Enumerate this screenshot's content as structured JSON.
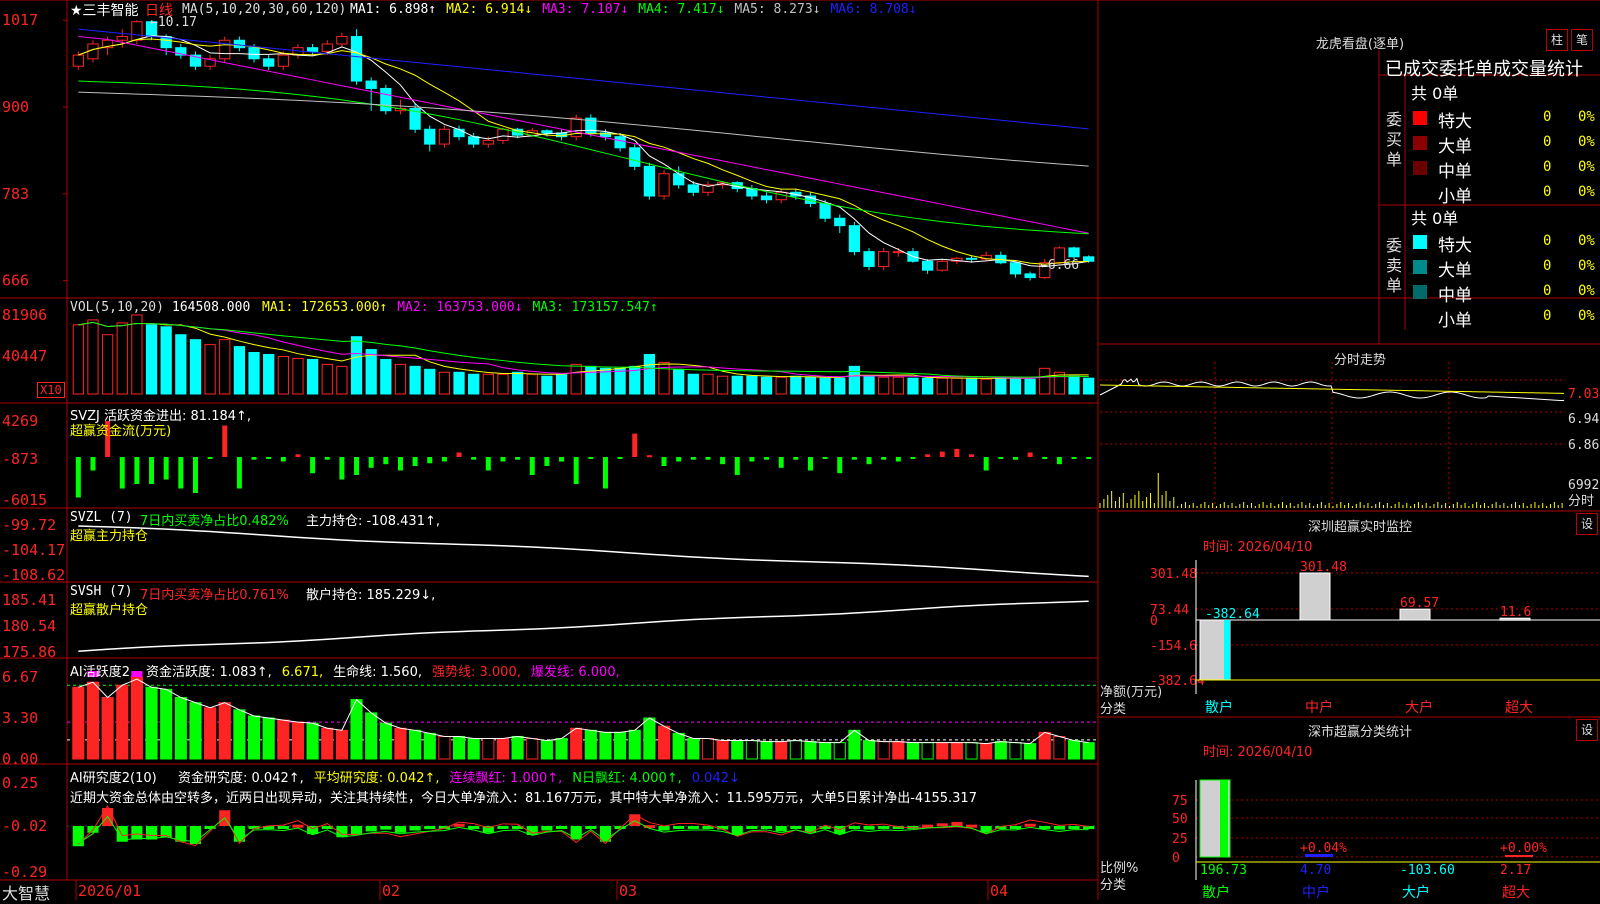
{
  "app": {
    "name": "大智慧"
  },
  "stock": {
    "title": "★三丰智能",
    "period": "日线"
  },
  "colors": {
    "up": "#ff2424",
    "down": "#00ffff",
    "grid": "#b00000",
    "bg": "#000000",
    "ma1": "#ffffff",
    "ma2": "#ffff00",
    "ma3": "#ff00ff",
    "ma4": "#00ff00",
    "ma5": "#c0c0c0",
    "ma6": "#2020ff"
  },
  "main_panel": {
    "indicator": "MA(5,10,20,30,60,120)",
    "items": [
      {
        "label": "MA1:",
        "value": "6.898",
        "arrow": "↑",
        "color": "#ffffff"
      },
      {
        "label": "MA2:",
        "value": "6.914",
        "arrow": "↓",
        "color": "#ffff00"
      },
      {
        "label": "MA3:",
        "value": "7.107",
        "arrow": "↓",
        "color": "#ff00ff"
      },
      {
        "label": "MA4:",
        "value": "7.417",
        "arrow": "↓",
        "color": "#00ff00"
      },
      {
        "label": "MA5:",
        "value": "8.273",
        "arrow": "↓",
        "color": "#c0c0c0"
      },
      {
        "label": "MA6:",
        "value": "8.708",
        "arrow": "↓",
        "color": "#2020ff"
      }
    ],
    "y_ticks": [
      "1017",
      "900",
      "783",
      "666"
    ],
    "high_label": "10.17",
    "low_label": "6.66"
  },
  "vol_panel": {
    "indicator": "VOL(5,10,20)",
    "value": "164508.000",
    "items": [
      {
        "label": "MA1:",
        "value": "172653.000",
        "arrow": "↑",
        "color": "#ffff00"
      },
      {
        "label": "MA2:",
        "value": "163753.000",
        "arrow": "↓",
        "color": "#ff00ff"
      },
      {
        "label": "MA3:",
        "value": "173157.547",
        "arrow": "↑",
        "color": "#00ff00"
      }
    ],
    "y_ticks": [
      "81906",
      "40447"
    ],
    "unit": "X10"
  },
  "svzj_panel": {
    "title": "SVZJ  活跃资金进出: 81.184↑,",
    "subtitle": "超赢资金流(万元)",
    "y_ticks": [
      "4269",
      "-873",
      "-6015"
    ]
  },
  "svzl_panel": {
    "title_a": "SVZL (7)",
    "title_b": "7日内买卖净占比0.482%",
    "title_c": "主力持仓: -108.431↑,",
    "subtitle": "超赢主力持仓",
    "y_ticks": [
      "-99.72",
      "-104.17",
      "-108.62"
    ]
  },
  "svsh_panel": {
    "title_a": "SVSH (7)",
    "title_b": "7日内买卖净占比0.761%",
    "title_c": "散户持仓: 185.229↓,",
    "subtitle": "超赢散户持仓",
    "y_ticks": [
      "185.41",
      "180.54",
      "175.86"
    ]
  },
  "ai_active_panel": {
    "title": "AI活跃度2",
    "items": [
      {
        "text": "资金活跃度: 1.083↑,",
        "color": "#ffffff"
      },
      {
        "text": "6.671,",
        "color": "#ffff00"
      },
      {
        "text": "生命线: 1.560,",
        "color": "#ffffff"
      },
      {
        "text": "强势线: 3.000,",
        "color": "#ff2424"
      },
      {
        "text": "爆发线: 6.000,",
        "color": "#ff00ff"
      }
    ],
    "y_ticks": [
      "6.67",
      "3.30",
      "0.00"
    ]
  },
  "ai_research_panel": {
    "title": "AI研究度2(10)",
    "items": [
      {
        "text": "资金研究度: 0.042↑,",
        "color": "#ffffff"
      },
      {
        "text": "平均研究度: 0.042↑,",
        "color": "#ffff00"
      },
      {
        "text": "连续飘红: 1.000↑,",
        "color": "#ff00ff"
      },
      {
        "text": "N日飘红: 4.000↑,",
        "color": "#00ff00"
      },
      {
        "text": "0.042↓",
        "color": "#2020ff"
      }
    ],
    "note": "近期大资金总体由空转多，近两日出现异动，关注其持续性，今日大单净流入：81.167万元，其中特大单净流入：11.595万元，大单5日累计净出-4155.317",
    "y_ticks": [
      "0.25",
      "-0.02",
      "-0.29"
    ]
  },
  "x_axis": {
    "labels": [
      "2026/01",
      "02",
      "03",
      "04"
    ]
  },
  "dragon_tiger": {
    "title": "龙虎看盘(逐单)",
    "btn_column": "柱",
    "btn_stroke": "笔",
    "header": "已成交委托单成交量统计",
    "buy": {
      "side_label": "委买单",
      "total": "共 0单",
      "rows": [
        {
          "name": "特大",
          "count": "0",
          "pct": "0%",
          "color": "#ff0000"
        },
        {
          "name": "大单",
          "count": "0",
          "pct": "0%",
          "color": "#8b0000"
        },
        {
          "name": "中单",
          "count": "0",
          "pct": "0%",
          "color": "#6a0000"
        },
        {
          "name": "小单",
          "count": "0",
          "pct": "0%",
          "color": "#000000"
        }
      ]
    },
    "sell": {
      "side_label": "委卖单",
      "total": "共 0单",
      "rows": [
        {
          "name": "特大",
          "count": "0",
          "pct": "0%",
          "color": "#00ffff"
        },
        {
          "name": "大单",
          "count": "0",
          "pct": "0%",
          "color": "#008b8b"
        },
        {
          "name": "中单",
          "count": "0",
          "pct": "0%",
          "color": "#006a6a"
        },
        {
          "name": "小单",
          "count": "0",
          "pct": "0%",
          "color": "#000000"
        }
      ]
    }
  },
  "intraday": {
    "title": "分时走势",
    "y_ticks": [
      "7.03",
      "6.94",
      "6.86"
    ],
    "vol_label": "6992",
    "unit": "分时"
  },
  "sz_monitor": {
    "title": "深圳超赢实时监控",
    "settings": "设",
    "time": "时间: 2026/04/10",
    "y_ticks": [
      "301.48",
      "73.44",
      "0",
      "-154.6",
      "-382.64"
    ],
    "axis_label_1": "净额(万元)",
    "axis_label_2": "分类",
    "categories": [
      "散户",
      "中户",
      "大户",
      "超大"
    ],
    "values": [
      -382.64,
      301.48,
      69.57,
      11.6
    ],
    "value_labels": [
      "-382.64",
      "301.48",
      "69.57",
      "11.6"
    ]
  },
  "sz_classify": {
    "title": "深市超赢分类统计",
    "settings": "设",
    "time": "时间: 2026/04/10",
    "y_ticks": [
      "75",
      "50",
      "25",
      "0"
    ],
    "axis_label_1": "比例%",
    "axis_label_2": "分类",
    "categories": [
      "散户",
      "中户",
      "大户",
      "超大"
    ],
    "pct_labels": [
      "",
      "+0.04%",
      "",
      "+0.00%"
    ],
    "values": [
      "196.73",
      "4.70",
      "-103.60",
      "2.17"
    ],
    "value_colors": [
      "#00ff00",
      "#2020ff",
      "#00ffff",
      "#ff2424"
    ]
  },
  "chart_data": {
    "type": "candlestick",
    "title": "三丰智能 日线",
    "x": [
      "2026/01",
      "02",
      "03",
      "04"
    ],
    "ylim": [
      6.6,
      10.2
    ],
    "price_high": 10.17,
    "price_low": 6.66,
    "candles": [
      [
        9.55,
        9.7,
        9.75,
        9.5
      ],
      [
        9.65,
        9.85,
        9.9,
        9.6
      ],
      [
        9.8,
        9.9,
        9.95,
        9.7
      ],
      [
        9.9,
        9.95,
        10.05,
        9.8
      ],
      [
        9.9,
        10.15,
        10.17,
        9.85
      ],
      [
        10.15,
        9.95,
        10.17,
        9.9
      ],
      [
        9.95,
        9.8,
        9.98,
        9.7
      ],
      [
        9.8,
        9.7,
        9.85,
        9.65
      ],
      [
        9.7,
        9.55,
        9.75,
        9.5
      ],
      [
        9.55,
        9.65,
        9.7,
        9.5
      ],
      [
        9.65,
        9.9,
        9.95,
        9.6
      ],
      [
        9.9,
        9.8,
        9.95,
        9.75
      ],
      [
        9.8,
        9.65,
        9.85,
        9.6
      ],
      [
        9.65,
        9.55,
        9.7,
        9.5
      ],
      [
        9.55,
        9.7,
        9.75,
        9.5
      ],
      [
        9.7,
        9.8,
        9.85,
        9.65
      ],
      [
        9.8,
        9.75,
        9.85,
        9.7
      ],
      [
        9.75,
        9.85,
        9.9,
        9.7
      ],
      [
        9.85,
        9.95,
        10.0,
        9.8
      ],
      [
        9.95,
        9.35,
        10.05,
        9.3
      ],
      [
        9.35,
        9.25,
        9.4,
        8.95
      ],
      [
        9.25,
        8.95,
        9.3,
        8.9
      ],
      [
        8.95,
        8.98,
        9.1,
        8.9
      ],
      [
        8.98,
        8.7,
        9.05,
        8.65
      ],
      [
        8.7,
        8.5,
        8.75,
        8.4
      ],
      [
        8.5,
        8.7,
        8.75,
        8.45
      ],
      [
        8.7,
        8.6,
        8.75,
        8.55
      ],
      [
        8.6,
        8.5,
        8.65,
        8.45
      ],
      [
        8.5,
        8.55,
        8.6,
        8.45
      ],
      [
        8.55,
        8.7,
        8.72,
        8.5
      ],
      [
        8.7,
        8.62,
        8.72,
        8.58
      ],
      [
        8.62,
        8.68,
        8.72,
        8.6
      ],
      [
        8.68,
        8.65,
        8.7,
        8.6
      ],
      [
        8.65,
        8.6,
        8.7,
        8.55
      ],
      [
        8.6,
        8.85,
        8.9,
        8.55
      ],
      [
        8.85,
        8.65,
        8.9,
        8.6
      ],
      [
        8.65,
        8.6,
        8.7,
        8.55
      ],
      [
        8.6,
        8.45,
        8.65,
        8.4
      ],
      [
        8.45,
        8.2,
        8.5,
        8.15
      ],
      [
        8.2,
        7.8,
        8.25,
        7.75
      ],
      [
        7.8,
        8.1,
        8.15,
        7.75
      ],
      [
        8.1,
        7.95,
        8.2,
        7.9
      ],
      [
        7.95,
        7.85,
        8.0,
        7.8
      ],
      [
        7.85,
        7.95,
        8.0,
        7.8
      ],
      [
        7.95,
        7.98,
        8.0,
        7.9
      ],
      [
        7.98,
        7.9,
        8.0,
        7.85
      ],
      [
        7.9,
        7.8,
        7.95,
        7.75
      ],
      [
        7.8,
        7.75,
        7.85,
        7.7
      ],
      [
        7.75,
        7.85,
        7.9,
        7.7
      ],
      [
        7.85,
        7.8,
        7.9,
        7.75
      ],
      [
        7.8,
        7.7,
        7.85,
        7.65
      ],
      [
        7.7,
        7.5,
        7.75,
        7.45
      ],
      [
        7.5,
        7.4,
        7.55,
        7.3
      ],
      [
        7.4,
        7.05,
        7.45,
        7.0
      ],
      [
        7.05,
        6.85,
        7.1,
        6.8
      ],
      [
        6.85,
        7.05,
        7.1,
        6.8
      ],
      [
        7.05,
        7.05,
        7.1,
        6.98
      ],
      [
        7.05,
        6.92,
        7.1,
        6.9
      ],
      [
        6.92,
        6.8,
        6.95,
        6.75
      ],
      [
        6.8,
        6.92,
        6.95,
        6.78
      ],
      [
        6.92,
        6.96,
        6.98,
        6.88
      ],
      [
        6.96,
        6.95,
        7.0,
        6.9
      ],
      [
        6.95,
        7.0,
        7.05,
        6.92
      ],
      [
        7.0,
        6.9,
        7.05,
        6.88
      ],
      [
        6.9,
        6.75,
        6.92,
        6.7
      ],
      [
        6.75,
        6.7,
        6.78,
        6.66
      ],
      [
        6.7,
        6.9,
        6.95,
        6.68
      ],
      [
        6.9,
        7.1,
        7.12,
        6.88
      ],
      [
        7.1,
        6.98,
        7.12,
        6.95
      ],
      [
        6.98,
        6.92,
        7.0,
        6.9
      ]
    ],
    "volume": [
      70,
      75,
      60,
      72,
      80,
      70,
      68,
      60,
      55,
      50,
      55,
      48,
      42,
      40,
      38,
      36,
      35,
      30,
      28,
      58,
      45,
      35,
      30,
      28,
      25,
      22,
      22,
      20,
      20,
      20,
      22,
      20,
      18,
      20,
      30,
      28,
      26,
      26,
      28,
      40,
      32,
      25,
      20,
      20,
      18,
      18,
      18,
      17,
      17,
      18,
      17,
      16,
      16,
      28,
      18,
      17,
      17,
      16,
      16,
      16,
      16,
      16,
      15,
      17,
      16,
      15,
      26,
      22,
      18,
      16
    ],
    "vol_ymax": 81906,
    "svzj": [
      -4.5,
      -1.5,
      4.0,
      -3.5,
      -3.0,
      -3.0,
      -2.5,
      -3.5,
      -4.0,
      -0.2,
      3.5,
      -3.5,
      -0.3,
      -0.2,
      -0.5,
      0.3,
      -1.8,
      -0.3,
      -2.5,
      -2.0,
      -1.2,
      -0.8,
      -1.5,
      -1.0,
      -0.7,
      -0.5,
      0.5,
      -0.3,
      -1.5,
      -0.5,
      -0.3,
      -2.0,
      -1.0,
      -0.5,
      -3.0,
      -0.2,
      -3.5,
      -0.2,
      2.6,
      0.2,
      -1.0,
      -0.5,
      -0.3,
      -0.3,
      -0.8,
      -2.0,
      -0.5,
      -0.3,
      -1.2,
      -0.3,
      -1.5,
      -0.2,
      -1.8,
      -0.3,
      -0.8,
      -0.3,
      -0.5,
      -0.2,
      0.3,
      0.6,
      0.9,
      0.3,
      -1.5,
      -0.2,
      -0.3,
      0.5,
      -0.2,
      -0.8,
      -0.2,
      -0.2
    ],
    "svzj_ylim": [
      -6015,
      4269
    ],
    "svzl_ylim": [
      -108.62,
      -99.72
    ],
    "svsh_ylim": [
      175.86,
      185.41
    ],
    "active_ylim": [
      0,
      6.67
    ],
    "research_ylim": [
      -0.29,
      0.25
    ],
    "sz_monitor_values": [
      -382.64,
      301.48,
      69.57,
      11.6
    ],
    "sz_classify_values": [
      196.73,
      4.7,
      -103.6,
      2.17
    ]
  }
}
